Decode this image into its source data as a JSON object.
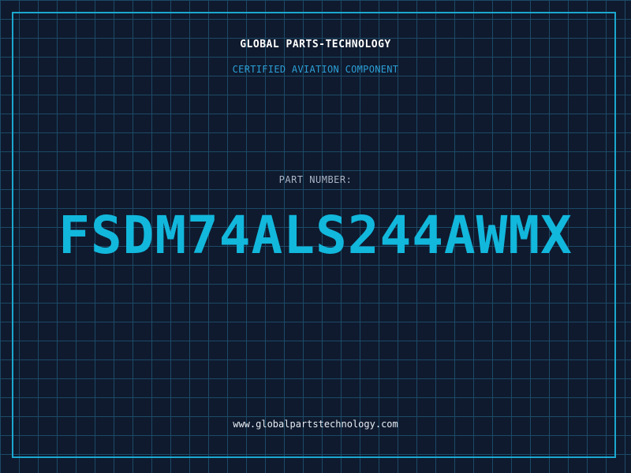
{
  "header": {
    "brand": "GLOBAL PARTS-TECHNOLOGY",
    "subtitle": "CERTIFIED AVIATION COMPONENT"
  },
  "part": {
    "label": "PART NUMBER:",
    "number": "FSDM74ALS244AWMX"
  },
  "footer": {
    "url": "www.globalpartstechnology.com"
  },
  "colors": {
    "background": "#0f1a2e",
    "grid": "#1c4a66",
    "frame": "#1ba8cf",
    "part_number": "#12b7dc",
    "subtitle": "#2b9fd6",
    "brand_text": "#ffffff",
    "label_text": "#a9b4c6",
    "url_text": "#e6ecf3"
  }
}
